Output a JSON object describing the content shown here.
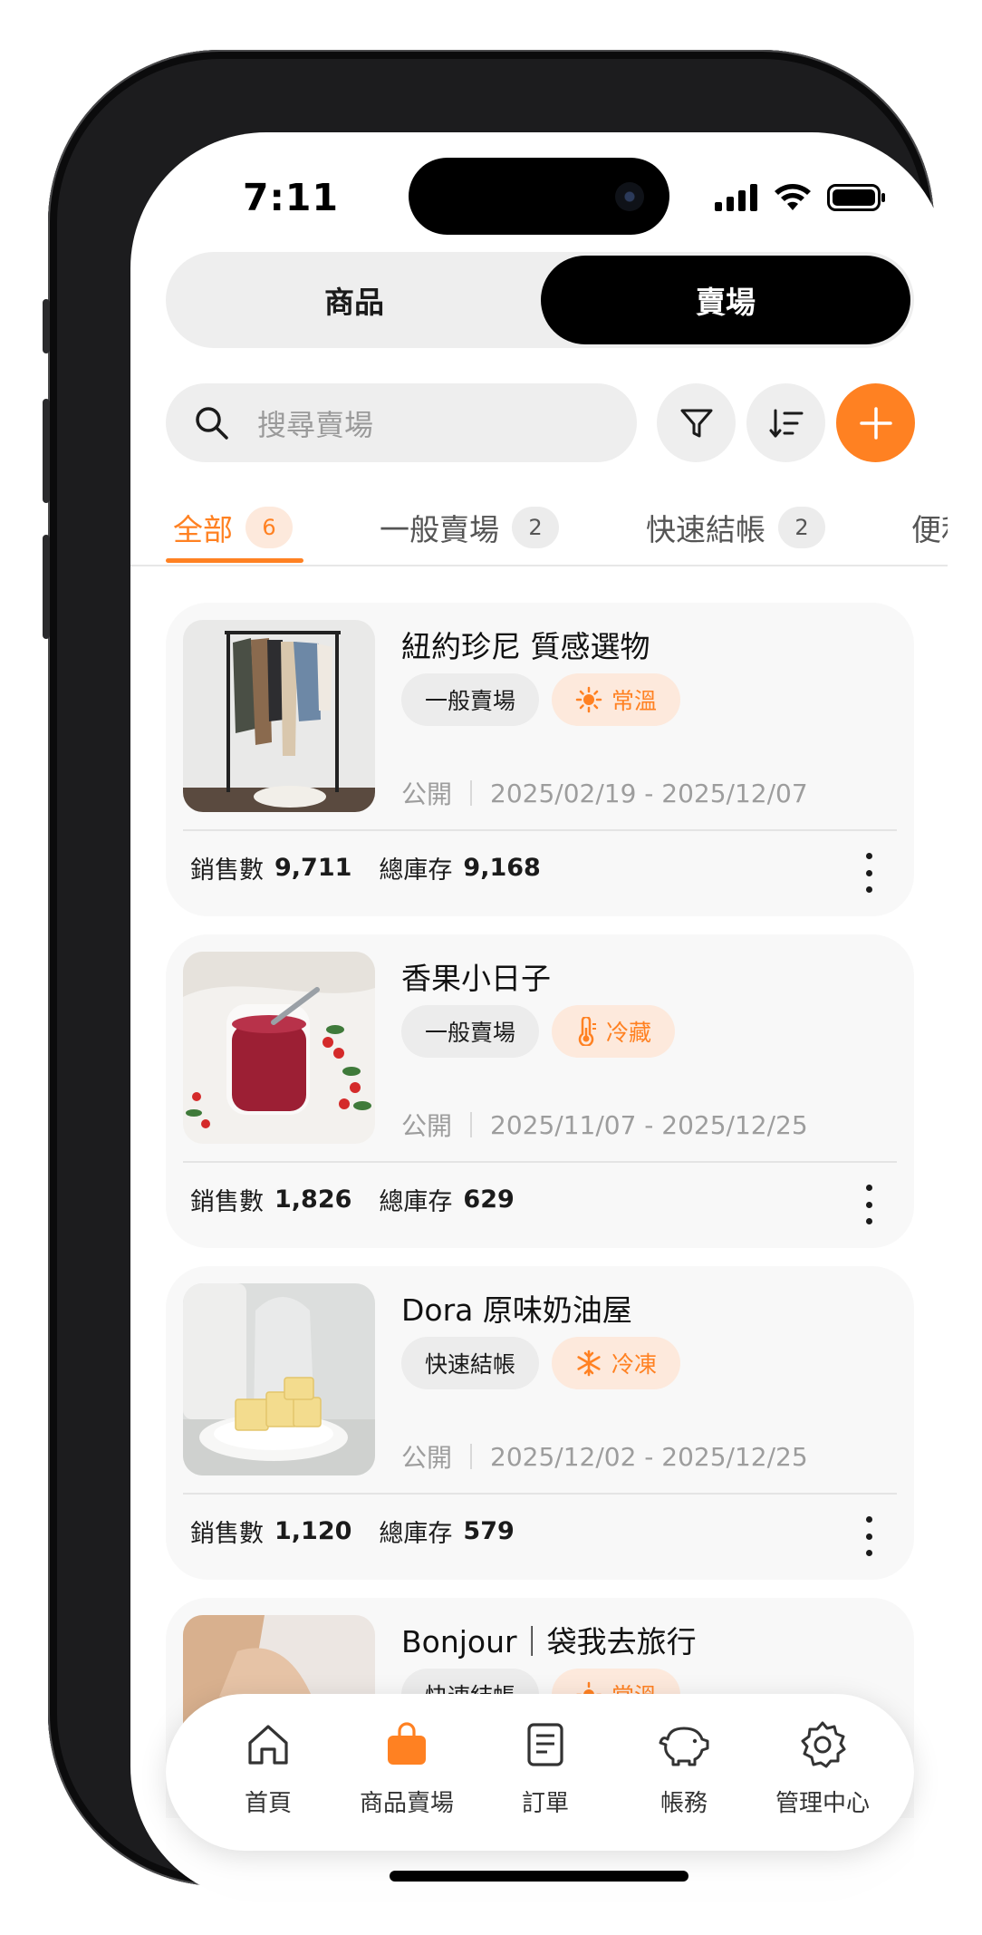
{
  "status_bar": {
    "time": "7:11"
  },
  "segment": {
    "left_label": "商品",
    "right_label": "賣場"
  },
  "search": {
    "placeholder": "搜尋賣場"
  },
  "tabs": [
    {
      "label": "全部",
      "count": "6"
    },
    {
      "label": "一般賣場",
      "count": "2"
    },
    {
      "label": "快速結帳",
      "count": "2"
    },
    {
      "label": "便利"
    }
  ],
  "cards": [
    {
      "title": "紐約珍尼 質感選物",
      "type": "一般賣場",
      "temp": "常溫",
      "temp_icon": "sun-icon",
      "visibility": "公開",
      "date_range": "2025/02/19 - 2025/12/07",
      "sales_label": "銷售數",
      "sales": "9,711",
      "stock_label": "總庫存",
      "stock": "9,168"
    },
    {
      "title": "香果小日子",
      "type": "一般賣場",
      "temp": "冷藏",
      "temp_icon": "thermometer-icon",
      "visibility": "公開",
      "date_range": "2025/11/07 - 2025/12/25",
      "sales_label": "銷售數",
      "sales": "1,826",
      "stock_label": "總庫存",
      "stock": "629"
    },
    {
      "title": "Dora 原味奶油屋",
      "type": "快速結帳",
      "temp": "冷凍",
      "temp_icon": "snowflake-icon",
      "visibility": "公開",
      "date_range": "2025/12/02 - 2025/12/25",
      "sales_label": "銷售數",
      "sales": "1,120",
      "stock_label": "總庫存",
      "stock": "579"
    },
    {
      "title": "Bonjour｜袋我去旅行",
      "type": "快速結帳",
      "temp": "常溫",
      "temp_icon": "sun-icon"
    }
  ],
  "bottom_nav": [
    {
      "label": "首頁",
      "icon": "home-icon"
    },
    {
      "label": "商品賣場",
      "icon": "shopping-bag-icon",
      "active": true
    },
    {
      "label": "訂單",
      "icon": "order-icon"
    },
    {
      "label": "帳務",
      "icon": "piggy-bank-icon"
    },
    {
      "label": "管理中心",
      "icon": "gear-icon"
    }
  ],
  "colors": {
    "accent": "#ff8122",
    "accent_soft": "#fde9dc",
    "chip_gray": "#ececec",
    "card_bg": "#f8f8f8"
  }
}
